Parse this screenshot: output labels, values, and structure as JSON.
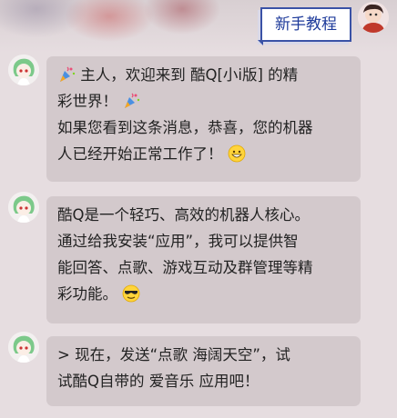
{
  "header": {
    "tutorial_button": "新手教程",
    "user_avatar_icon": "user-avatar-icon"
  },
  "messages": [
    {
      "id": "msg1",
      "lines": [
        {
          "pre_icon": "party-popper-icon",
          "text": " 主人，欢迎来到 酷Q[小i版] 的精"
        },
        {
          "text": "彩世界！ ",
          "post_icon": "party-popper-icon"
        },
        {
          "text": "如果您看到这条消息，恭喜，您的机器"
        },
        {
          "text": "人已经开始正常工作了！ ",
          "post_icon": "grinning-face-icon"
        }
      ]
    },
    {
      "id": "msg2",
      "lines": [
        {
          "text": "酷Q是一个轻巧、高效的机器人核心。"
        },
        {
          "text": "通过给我安装“应用”，我可以提供智"
        },
        {
          "text": "能回答、点歌、游戏互动及群管理等精"
        },
        {
          "text": "彩功能。 ",
          "post_icon": "sunglasses-face-icon"
        }
      ]
    },
    {
      "id": "msg3",
      "lines": [
        {
          "text": "> 现在，发送“点歌 海阔天空”，试"
        },
        {
          "text": "试酷Q自带的 爱音乐 应用吧！"
        }
      ]
    }
  ],
  "bot_avatar_icon": "bot-avatar-icon",
  "colors": {
    "background": "#e6dde0",
    "bubble": "#d3c9cc",
    "button_border": "#3a52a6",
    "button_text": "#1d3a9a"
  }
}
